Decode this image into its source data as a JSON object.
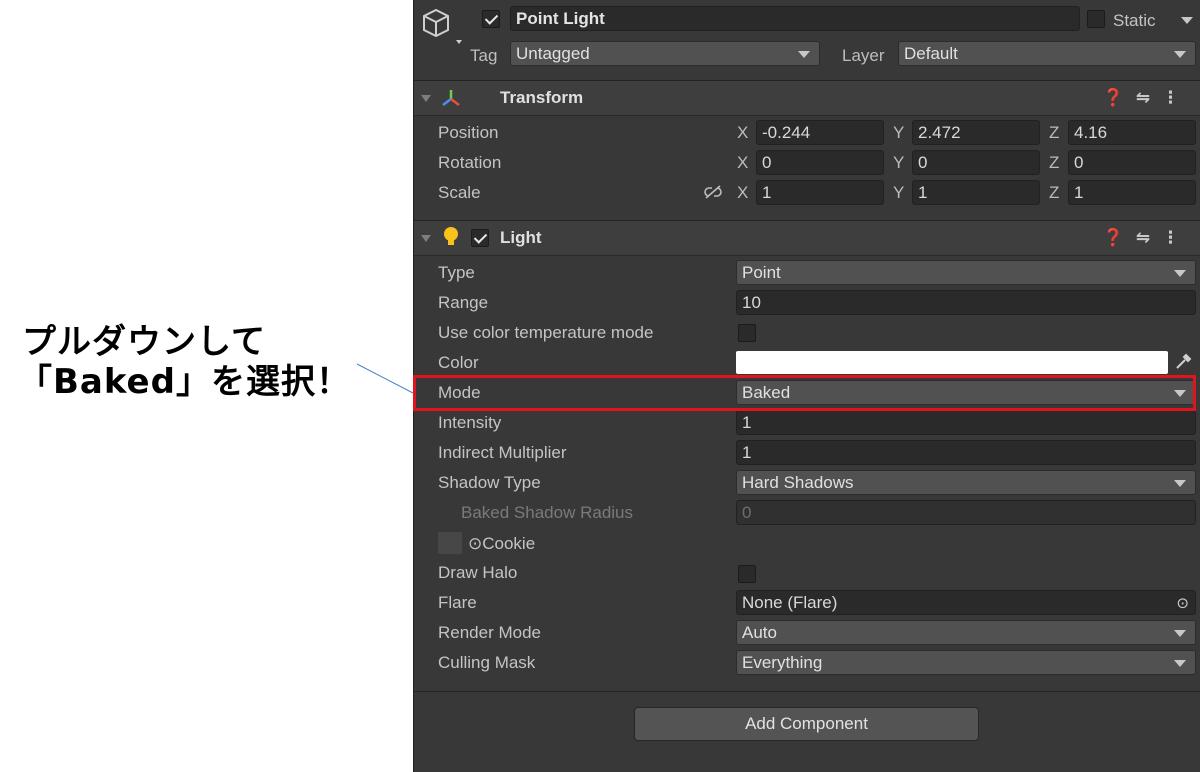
{
  "annotation": {
    "line1": "プルダウンして",
    "line2": "「Baked」を選択！"
  },
  "header": {
    "object_name": "Point Light",
    "static_label": "Static",
    "tag_label": "Tag",
    "tag_value": "Untagged",
    "layer_label": "Layer",
    "layer_value": "Default"
  },
  "transform": {
    "title": "Transform",
    "rows": [
      {
        "label": "Position",
        "x": "-0.244",
        "y": "2.472",
        "z": "4.16"
      },
      {
        "label": "Rotation",
        "x": "0",
        "y": "0",
        "z": "0"
      },
      {
        "label": "Scale",
        "x": "1",
        "y": "1",
        "z": "1"
      }
    ],
    "axis_labels": {
      "x": "X",
      "y": "Y",
      "z": "Z"
    }
  },
  "light": {
    "title": "Light",
    "type_label": "Type",
    "type_value": "Point",
    "range_label": "Range",
    "range_value": "10",
    "use_temp_label": "Use color temperature mode",
    "color_label": "Color",
    "color_value": "#ffffff",
    "mode_label": "Mode",
    "mode_value": "Baked",
    "intensity_label": "Intensity",
    "intensity_value": "1",
    "indirect_label": "Indirect Multiplier",
    "indirect_value": "1",
    "shadow_label": "Shadow Type",
    "shadow_value": "Hard Shadows",
    "baked_radius_label": "Baked Shadow Radius",
    "baked_radius_value": "0",
    "cookie_label": "⊙Cookie",
    "draw_halo_label": "Draw Halo",
    "flare_label": "Flare",
    "flare_value": "None (Flare)",
    "render_mode_label": "Render Mode",
    "render_mode_value": "Auto",
    "culling_label": "Culling Mask",
    "culling_value": "Everything"
  },
  "add_component_label": "Add Component",
  "colors": {
    "highlight": "#e0141c",
    "inspector_bg": "#383838"
  }
}
